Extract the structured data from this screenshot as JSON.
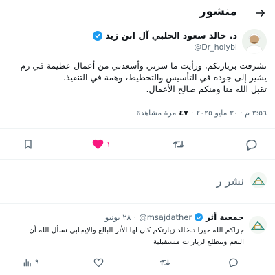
{
  "header": {
    "title": "منشور"
  },
  "post": {
    "author_name": "د. خالد سعود الحلبي آل ابن زيد",
    "handle": "@Dr_holybi",
    "text_lines": [
      "تشرفت بزيارتكم، ورأيت ما سرني وأسعدني من أعمال عظيمة في زم",
      "يشير إلى جودة في التأسيس والتخطيط، وهمة في التنفيذ.",
      "تقبل الله منا ومنكم صالح الأعمال."
    ],
    "time": "٣:٥٦ م · ٣٠ مايو ٢٠٢٥",
    "views_count": "٤٧",
    "views_label": "مرة مشاهدة",
    "like_count": "١",
    "colors": {
      "like": "#f91880",
      "accent": "#1d9bf0"
    }
  },
  "reply_box": {
    "placeholder": "نشر ر"
  },
  "reply": {
    "author_name": "جمعية أثر",
    "handle": "@msajdather",
    "date": "٢٨ يونيو",
    "text_lines": [
      "جزاكم الله خيرا د.خالد زيارتكم كان لها الأثر البالغ والإيجابي نسأل الله أن",
      "النعم ونتطلع لزيارات مستقبلية"
    ],
    "views_count": "٩"
  },
  "icons": {
    "back": "arrow-right-icon",
    "verified": "verified-badge-icon",
    "bookmark": "bookmark-icon",
    "like": "heart-icon",
    "retweet": "retweet-icon",
    "reply": "reply-icon",
    "views": "views-icon"
  }
}
